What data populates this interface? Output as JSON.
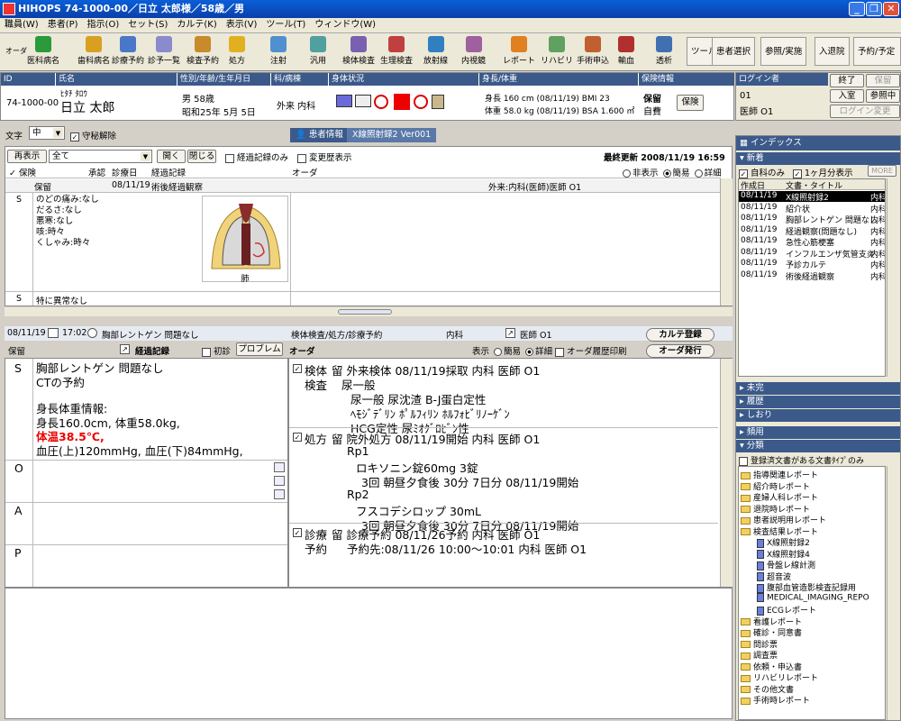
{
  "titlebar": {
    "title": "HIHOPS 74-1000-00／日立 太郎様／58歳／男"
  },
  "menu": [
    "職員(W)",
    "患者(P)",
    "指示(O)",
    "セット(S)",
    "カルテ(K)",
    "表示(V)",
    "ツール(T)",
    "ウィンドウ(W)"
  ],
  "toolbar": {
    "order_label": "オーダ",
    "items": [
      "医科病名",
      "歯科病名",
      "診療予約",
      "診予一覧",
      "検査予約",
      "処方",
      "注射",
      "汎用",
      "検体検査",
      "生理検査",
      "放射線",
      "内視鏡",
      "レポート",
      "リハビリ",
      "手術申込",
      "輸血",
      "透析"
    ],
    "tool_label": "ツール",
    "right_buttons": [
      "患者選択",
      "参照/実施",
      "入退院",
      "予約/予定"
    ]
  },
  "patient": {
    "headers": {
      "id": "ID",
      "name": "氏名",
      "sex_age": "性別/年齢/生年月日",
      "dept": "科/病棟",
      "body": "身体状況",
      "height_weight": "身長/体重",
      "insurance": "保険情報",
      "login": "ログイン者"
    },
    "id": "74-1000-00",
    "kana": "ﾋﾀﾁ ﾀﾛｳ",
    "name": "日立 太郎",
    "sex_age": "男  58歳",
    "birth": "昭和25年 5月 5日",
    "dept": "外来 内科",
    "height": "身長 160 cm (08/11/19) BMI 23",
    "weight": "体重 58.0 kg (08/11/19) BSA 1.600 ㎡",
    "ins_status": "保留",
    "ins_type": "自費",
    "ins_btn": "保険",
    "login_dept": "01",
    "login_user": "医師 O1",
    "btn_end": "終了",
    "btn_hold": "保留",
    "btn_enter": "入室",
    "btn_ref": "参照中",
    "btn_login_change": "ログイン変更"
  },
  "size": {
    "label": "文字",
    "value": "中",
    "guard": "守秘解除"
  },
  "tabs": {
    "patient_info": "患者情報",
    "xray": "X線照射録2 Ver001"
  },
  "history": {
    "refresh": "再表示",
    "filter": "全て",
    "open": "開く",
    "close": "閉じる",
    "only_progress": "経過記録のみ",
    "change_history": "変更歴表示",
    "last_update": "最終更新 2008/11/19 16:59",
    "cols": {
      "ins": "保険",
      "approve": "承認",
      "date": "診療日",
      "record": "経過記録",
      "order": "オーダ"
    },
    "view": {
      "hidden": "非表示",
      "simple": "簡易",
      "detail": "詳細"
    },
    "entry": {
      "ins": "保留",
      "date": "08/11/19",
      "record": "術後経過観察",
      "order": "外来:内科(医師)医師 O1"
    },
    "s_label": "S",
    "s_lines": [
      "のどの痛み:なし",
      "だるさ:なし",
      "悪寒:なし",
      "咳:時々",
      "くしゃみ:時々"
    ],
    "img_caption": "肺",
    "s2_text": "特に異常なし"
  },
  "editor": {
    "date": "08/11/19",
    "time": "17:02",
    "title": "胸部レントゲン  問題なし",
    "ins": "保留",
    "progress_label": "経過記録",
    "first_visit": "初診",
    "problem_btn": "プロブレム",
    "order_header": "検体検査/処方/診療予約",
    "order_dept": "内科",
    "order_doctor": "医師 O1",
    "karte_btn": "カルテ登録",
    "order_btn": "オーダ発行",
    "order_label": "オーダ",
    "display": "表示",
    "simple": "簡易",
    "detail": "詳細",
    "history_print": "オーダ履歴印刷",
    "soap": {
      "S": "S",
      "O": "O",
      "A": "A",
      "P": "P"
    },
    "s_text1": "胸部レントゲン  問題なし",
    "s_text2": "CTの予約",
    "vitals_title": "身長体重情報:",
    "vitals1": "身長160.0cm, 体重58.0kg,",
    "vitals_temp": "体温38.5℃,",
    "vitals2": "血圧(上)120mmHg, 血圧(下)84mmHg,"
  },
  "orders": [
    {
      "label1": "検体",
      "label2": "検査",
      "title": "留 外来検体 08/11/19採取 内科   医師 O1",
      "lines": [
        "尿一般",
        "尿一般 尿沈渣 B-J蛋白定性",
        "ﾍﾓｼﾞﾃﾞﾘﾝ ﾎﾟﾙﾌｨﾘﾝ ﾎﾙﾌｫﾋﾞﾘﾉｰｹﾞﾝ",
        "HCG定性 尿ﾐｵｸﾞﾛﾋﾞﾝ性"
      ]
    },
    {
      "label1": "処方",
      "label2": "",
      "title": "留 院外処方 08/11/19開始 内科   医師 O1",
      "lines": [
        "Rp1",
        "ロキソニン錠60mg 3錠",
        "3回 朝昼夕食後 30分 7日分 08/11/19開始",
        "Rp2",
        "フスコデシロップ 30mL",
        "3回 朝昼夕食後 30分 7日分 08/11/19開始"
      ]
    },
    {
      "label1": "診療",
      "label2": "予約",
      "title": "留 診療予約 08/11/26予約 内科   医師 O1",
      "lines": [
        "予約先:08/11/26 10:00〜10:01 内科   医師 O1"
      ]
    }
  ],
  "index": {
    "title": "インデックス",
    "new": "新着",
    "own_dept": "自科のみ",
    "one_month": "1ヶ月分表示",
    "more": "MORE",
    "col_date": "作成日",
    "col_title": "文書・タイトル",
    "rows": [
      {
        "date": "08/11/19",
        "title": "X線照射録2",
        "extra": "内科"
      },
      {
        "date": "08/11/19",
        "title": "紹介状",
        "extra": "内科"
      },
      {
        "date": "08/11/19",
        "title": "胸部レントゲン 問題なし",
        "extra": "内科"
      },
      {
        "date": "08/11/19",
        "title": "経過観察(問題なし)",
        "extra": "内科"
      },
      {
        "date": "08/11/19",
        "title": "急性心筋梗塞",
        "extra": "内科"
      },
      {
        "date": "08/11/19",
        "title": "インフルエンザ気管支炎",
        "extra": "内科"
      },
      {
        "date": "08/11/19",
        "title": "予診カルテ",
        "extra": "内科"
      },
      {
        "date": "08/11/19",
        "title": "術後経過観察",
        "extra": "内科"
      }
    ],
    "unfinished": "未完",
    "history": "履歴",
    "bookmark": "しおり",
    "frequent": "頻用",
    "category": "分類",
    "registered_only": "登録済文書がある文書ﾀｲﾌﾟのみ",
    "tree": [
      {
        "t": "指導関連レポート",
        "k": "f",
        "l": 0
      },
      {
        "t": "紹介時レポート",
        "k": "f",
        "l": 0
      },
      {
        "t": "産婦人科レポート",
        "k": "f",
        "l": 0
      },
      {
        "t": "退院時レポート",
        "k": "f",
        "l": 0
      },
      {
        "t": "患者説明用レポート",
        "k": "f",
        "l": 0
      },
      {
        "t": "検査結果レポート",
        "k": "f",
        "l": 0
      },
      {
        "t": "X線照射録2",
        "k": "d",
        "l": 1
      },
      {
        "t": "X線照射録4",
        "k": "d",
        "l": 1
      },
      {
        "t": "骨盤レ線計測",
        "k": "d",
        "l": 1
      },
      {
        "t": "超音波",
        "k": "d",
        "l": 1
      },
      {
        "t": "腹部血管造影検査記録用",
        "k": "d",
        "l": 1
      },
      {
        "t": "MEDICAL_IMAGING_REPO",
        "k": "d",
        "l": 1
      },
      {
        "t": "ECGレポート",
        "k": "d",
        "l": 1
      },
      {
        "t": "看護レポート",
        "k": "f",
        "l": 0
      },
      {
        "t": "確診・同意書",
        "k": "f",
        "l": 0
      },
      {
        "t": "問診票",
        "k": "f",
        "l": 0
      },
      {
        "t": "調査票",
        "k": "f",
        "l": 0
      },
      {
        "t": "依頼・申込書",
        "k": "f",
        "l": 0
      },
      {
        "t": "リハビリレポート",
        "k": "f",
        "l": 0
      },
      {
        "t": "その他文書",
        "k": "f",
        "l": 0
      },
      {
        "t": "手術時レポート",
        "k": "f",
        "l": 0
      }
    ]
  }
}
